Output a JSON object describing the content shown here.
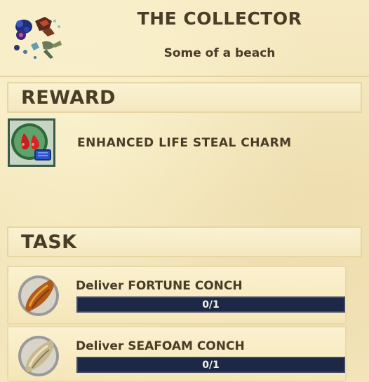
{
  "quest": {
    "icon": "item-collection-icon",
    "title": "THE COLLECTOR",
    "subtitle": "Some of a beach"
  },
  "reward": {
    "heading": "REWARD",
    "item_icon": "life-steal-charm-icon",
    "item_name": "ENHANCED LIFE STEAL CHARM"
  },
  "task": {
    "heading": "TASK",
    "items": [
      {
        "label": "Deliver FORTUNE CONCH",
        "progress": "0/1",
        "fraction": 0,
        "icon": "fortune-conch-icon"
      },
      {
        "label": "Deliver SEAFOAM CONCH",
        "progress": "0/1",
        "fraction": 0,
        "icon": "seafoam-conch-icon"
      }
    ]
  },
  "colors": {
    "text": "#4a3d28",
    "parchment": "#f3e6bc",
    "progress_bg": "#1d2847"
  }
}
